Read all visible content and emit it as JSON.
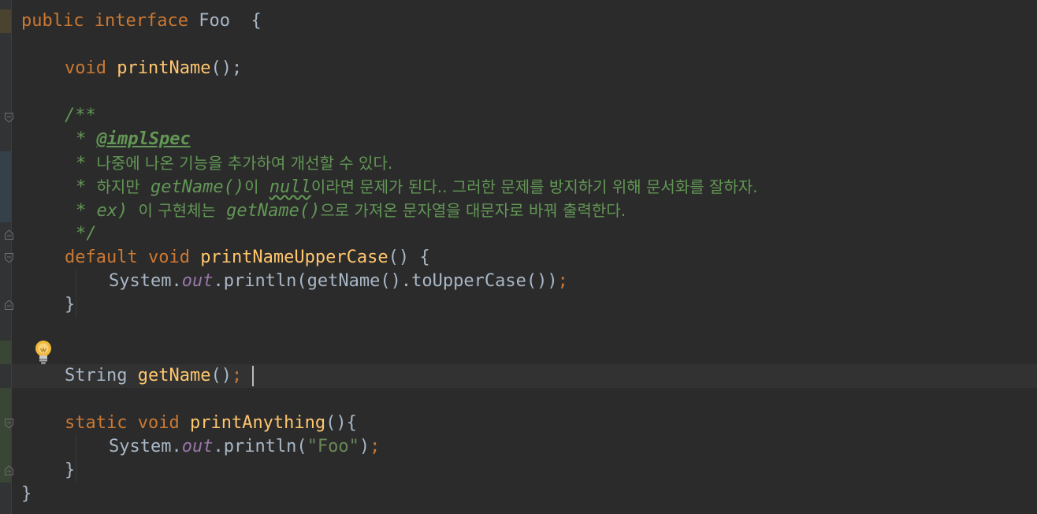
{
  "colors": {
    "background": "#2b2b2b",
    "keyword": "#cc7832",
    "method_declaration": "#ffc66d",
    "identifier": "#a9b7c6",
    "doc_comment": "#629755",
    "static_field": "#9876aa",
    "string": "#6a8759",
    "gutter_changed": "#394535",
    "gutter_modified": "#34414b"
  },
  "icons": {
    "intention": "lightbulb-icon",
    "fold": "fold-marker-icon"
  },
  "code": {
    "line1": {
      "kw1": "public",
      "kw2": "interface",
      "name": "Foo",
      "brace": "{"
    },
    "line2": {
      "kw": "void",
      "method": "printName",
      "rest": "();"
    },
    "line3": {
      "open": "/**"
    },
    "line4": {
      "star": "*",
      "tag": "@implSpec"
    },
    "line5": {
      "star": "*",
      "text": "나중에 나온 기능을 추가하여 개선할 수 있다."
    },
    "line6": {
      "star": "*",
      "text1": "하지만",
      "code1": "getName()",
      "text2": "이",
      "code2": "null",
      "text3": "이라면 문제가 된다.. 그러한 문제를 방지하기 위해 문서화를 잘하자."
    },
    "line7": {
      "star": "*",
      "code1": "ex)",
      "text1": "이 구현체는",
      "code2": "getName()",
      "text2": "으로 가져온 문자열을 대문자로 바꿔 출력한다."
    },
    "line8": {
      "close": "*/"
    },
    "line9": {
      "kw1": "default",
      "kw2": "void",
      "method": "printNameUpperCase",
      "rest": "() {"
    },
    "line10": {
      "obj": "System.",
      "field": "out",
      "call": ".println(getName().toUpperCase())",
      "semi": ";"
    },
    "line11": {
      "brace": "}"
    },
    "line12": {
      "type": "String",
      "method": "getName",
      "rest": "()",
      "semi": ";"
    },
    "line13": {
      "kw1": "static",
      "kw2": "void",
      "method": "printAnything",
      "rest": "(){"
    },
    "line14": {
      "obj": "System.",
      "field": "out",
      "call": ".println(",
      "str": "\"Foo\"",
      "close": ")",
      "semi": ";"
    },
    "line15": {
      "brace": "}"
    },
    "line16": {
      "brace": "}"
    }
  }
}
